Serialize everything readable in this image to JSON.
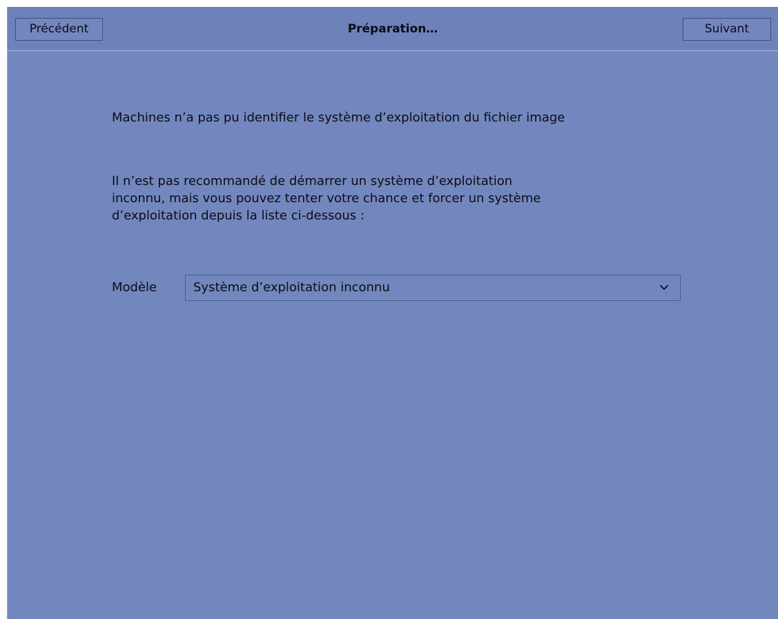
{
  "header": {
    "back_label": "Précédent",
    "title": "Préparation…",
    "next_label": "Suivant"
  },
  "message": {
    "line1": "Machines n’a pas pu identifier le système d’exploitation du fichier image",
    "paragraph": [
      "Il n’est pas recommandé de démarrer un système d’exploitation",
      "inconnu, mais vous pouvez tenter votre chance et forcer un système",
      "d’exploitation depuis la liste ci-dessous :"
    ]
  },
  "model": {
    "label": "Modèle",
    "selected": "Système d’exploitation inconnu",
    "icon": "chevron-down-icon"
  },
  "colors": {
    "background": "#7387bf",
    "header": "#6e82ba",
    "text": "#0c0c14"
  }
}
